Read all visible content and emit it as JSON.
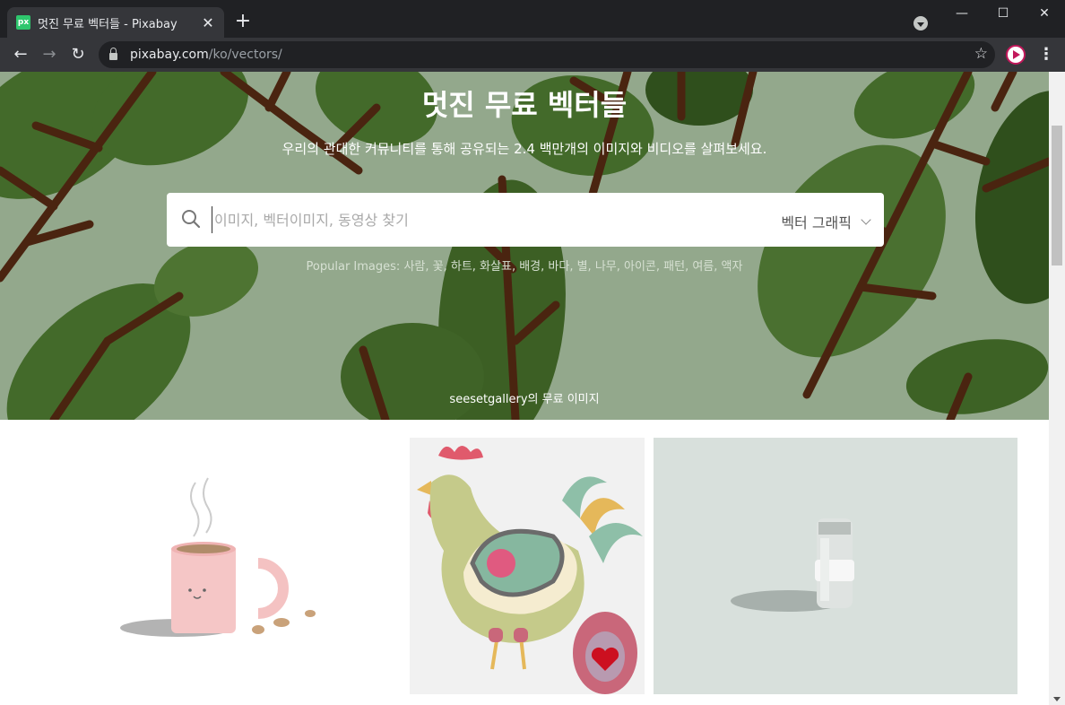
{
  "browser": {
    "tab_title": "멋진 무료 벡터들 - Pixabay",
    "favicon_label": "px",
    "url_host": "pixabay.com",
    "url_path": "/ko/vectors/",
    "icons": [
      "back-icon",
      "forward-icon",
      "reload-icon",
      "lock-icon",
      "bookmark-star-icon",
      "profile-icon",
      "menu-icon",
      "tab-search-icon",
      "minimize-icon",
      "maximize-icon",
      "close-icon"
    ]
  },
  "hero": {
    "title": "멋진 무료 벡터들",
    "subtitle": "우리의 관대한 커뮤니티를 통해 공유되는 2.4 백만개의 이미지와 비디오를 살펴보세요.",
    "search_placeholder": "이미지, 벡터이미지, 동영상 찾기",
    "search_type": "벡터 그래픽",
    "popular_label": "Popular Images:",
    "popular_keywords": [
      "사람",
      "꽃",
      "하트",
      "화살표",
      "배경",
      "바다",
      "별",
      "나무",
      "아이콘",
      "패턴",
      "여름",
      "액자"
    ],
    "credit_user": "seesetgallery",
    "credit_suffix": "의 무료 이미지"
  },
  "gallery": {
    "items": [
      {
        "subject": "pink coffee mug"
      },
      {
        "subject": "rooster and egg"
      },
      {
        "subject": "medicine bottle with mask"
      }
    ]
  },
  "colors": {
    "chrome_dark": "#202124",
    "chrome_tab": "#35363a",
    "hero_bg": "#93a88c",
    "leaf_dark": "#3e6226",
    "vein": "#4a2410"
  }
}
